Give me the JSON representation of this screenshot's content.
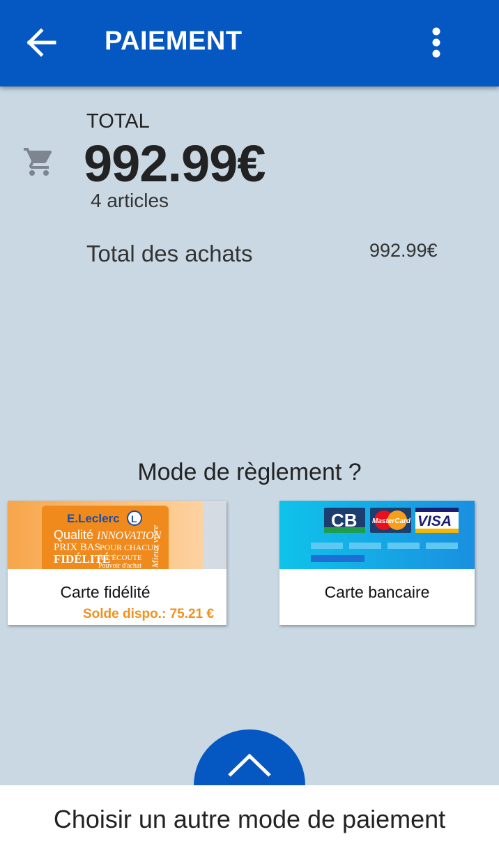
{
  "app_bar": {
    "title": "PAIEMENT",
    "color": "#0557c2"
  },
  "summary": {
    "total_label": "TOTAL",
    "total_amount": "992.99€",
    "articles": "4 articles",
    "purchases_label": "Total des achats",
    "purchases_value": "992.99€"
  },
  "payment": {
    "title": "Mode de règlement ?",
    "options": [
      {
        "label": "Carte fidélité",
        "balance": "Solde dispo.: 75.21 €",
        "image_text": {
          "brand": "E.Leclerc",
          "line1a": "Qualité",
          "line1b": "INNOVATION",
          "line2a": "PRIX BAS",
          "line2b": "POUR CHACUN",
          "line3a": "FIDÉLITÉ",
          "line3b": "À L'ÉCOUTE",
          "line4": "Pouvoir d'achat",
          "side": "Mieux vivre"
        }
      },
      {
        "label": "Carte bancaire",
        "logos": {
          "cb": "CB",
          "mastercard": "MasterCard",
          "visa": "VISA"
        }
      }
    ]
  },
  "bottom": {
    "label": "Choisir un autre mode de paiement"
  },
  "colors": {
    "accent": "#0557c2",
    "background": "#c9d8e3",
    "balance": "#f0901e"
  }
}
